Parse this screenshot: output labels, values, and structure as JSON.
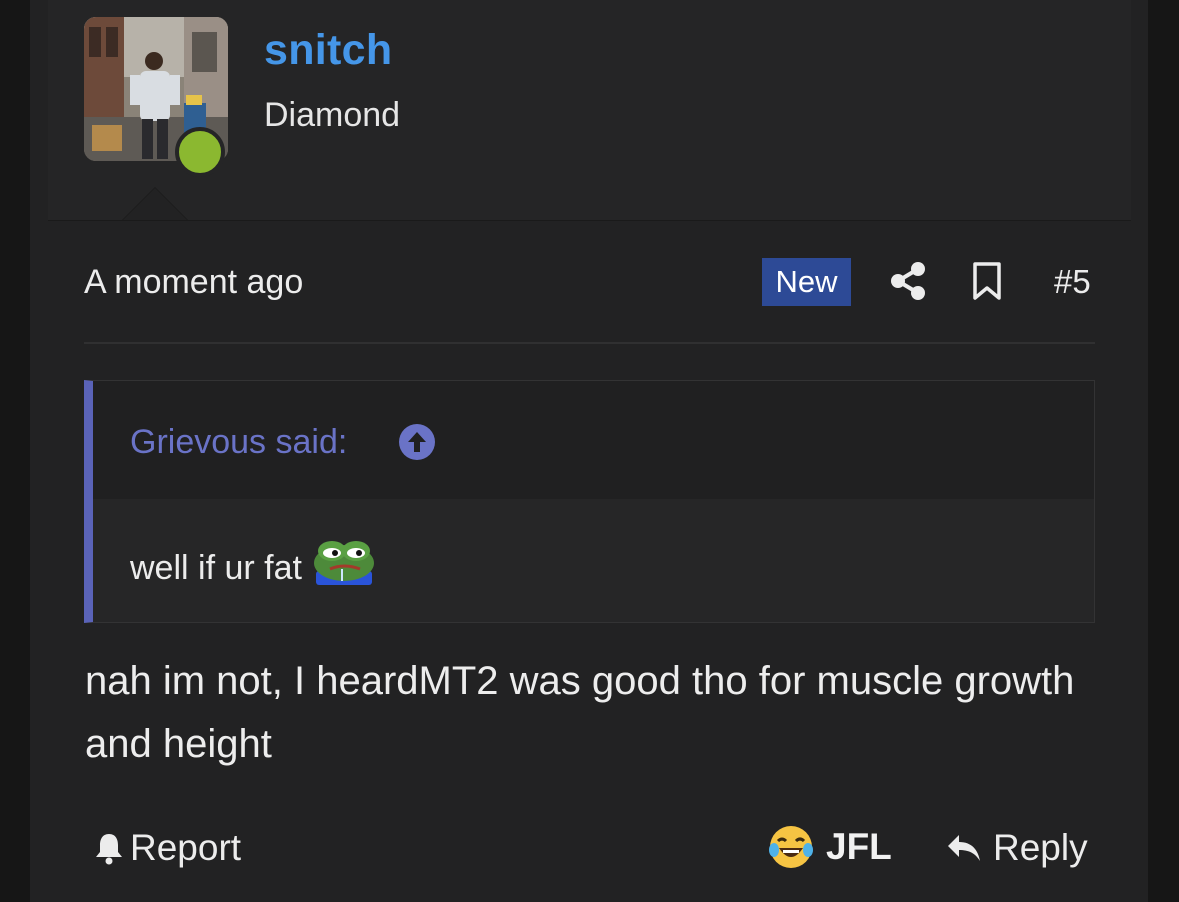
{
  "user": {
    "name": "snitch",
    "title": "Diamond",
    "status_color": "#8bb830"
  },
  "meta": {
    "timestamp": "A moment ago",
    "badge": "New",
    "post_number": "#5",
    "share_icon": "share-icon",
    "bookmark_icon": "bookmark-icon"
  },
  "quote": {
    "author": "Grievous said:",
    "text": "well if ur fat",
    "accent_color": "#5a63b8"
  },
  "message": "nah im not, I heardMT2 was good tho for muscle growth and height",
  "footer": {
    "report_label": "Report",
    "reaction_label": "JFL",
    "reply_label": "Reply"
  },
  "colors": {
    "username": "#4596e8",
    "badge_bg": "#2d4a96",
    "quote_author": "#6a73c7"
  }
}
